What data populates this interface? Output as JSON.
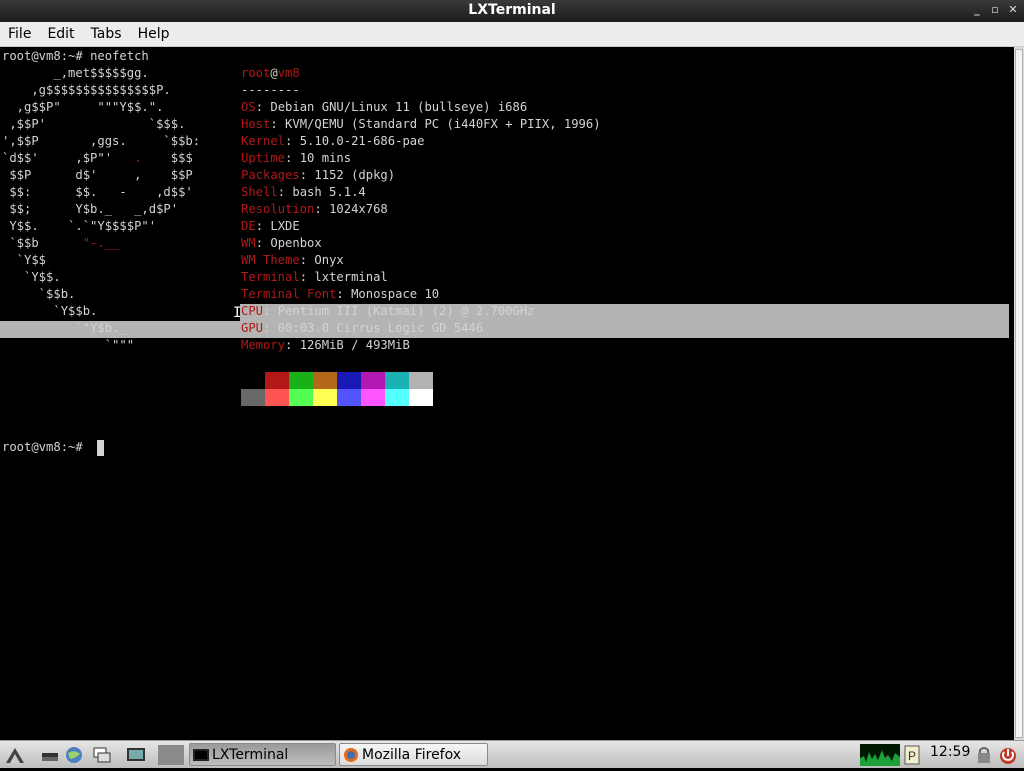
{
  "window": {
    "title": "LXTerminal",
    "buttons": [
      "_",
      "▫",
      "✕"
    ]
  },
  "menu": [
    "File",
    "Edit",
    "Tabs",
    "Help"
  ],
  "terminal": {
    "prompt": "root@vm8:~# ",
    "command": "neofetch",
    "prompt2": "root@vm8:~# ",
    "user": "root",
    "at": "@",
    "host": "vm8",
    "separator": "--------",
    "logo": [
      "       _,met$$$$$gg.",
      "    ,g$$$$$$$$$$$$$$$P.",
      "  ,g$$P\"     \"\"\"Y$$.\".",
      " ,$$P'              `$$$.",
      "',$$P       ,ggs.     `$$b:",
      "`d$$'     ,$P\"'   .    $$$",
      " $$P      d$'     ,    $$P",
      " $$:      $$.   -    ,d$$'",
      " $$;      Y$b._   _,d$P'",
      " Y$$.    `.`\"Y$$$$P\"'",
      " `$$b      \"-.__",
      "  `Y$$",
      "   `Y$$.",
      "     `$$b.",
      "       `Y$$b.",
      "          `\"Y$b._",
      "              `\"\"\""
    ],
    "info": [
      {
        "label": "OS",
        "value": "Debian GNU/Linux 11 (bullseye) i686"
      },
      {
        "label": "Host",
        "value": "KVM/QEMU (Standard PC (i440FX + PIIX, 1996)"
      },
      {
        "label": "Kernel",
        "value": "5.10.0-21-686-pae"
      },
      {
        "label": "Uptime",
        "value": "10 mins"
      },
      {
        "label": "Packages",
        "value": "1152 (dpkg)"
      },
      {
        "label": "Shell",
        "value": "bash 5.1.4"
      },
      {
        "label": "Resolution",
        "value": "1024x768"
      },
      {
        "label": "DE",
        "value": "LXDE"
      },
      {
        "label": "WM",
        "value": "Openbox"
      },
      {
        "label": "WM Theme",
        "value": "Onyx"
      },
      {
        "label": "Terminal",
        "value": "lxterminal"
      },
      {
        "label": "Terminal Font",
        "value": "Monospace 10"
      },
      {
        "label": "CPU",
        "value": "Pentium III (Katmai) (2) @ 2.700GHz"
      },
      {
        "label": "GPU",
        "value": "00:03.0 Cirrus Logic GD 5446"
      },
      {
        "label": "Memory",
        "value": "126MiB / 493MiB"
      }
    ],
    "palette_top": [
      "#000000",
      "#b21818",
      "#18b218",
      "#b26818",
      "#1818b2",
      "#b218b2",
      "#18b2b2",
      "#b2b2b2"
    ],
    "palette_bottom": [
      "#686868",
      "#ff5454",
      "#54ff54",
      "#ffff54",
      "#5454ff",
      "#ff54ff",
      "#54ffff",
      "#ffffff"
    ]
  },
  "taskbar": {
    "tasks": [
      {
        "label": "LXTerminal",
        "active": true
      },
      {
        "label": "Mozilla Firefox",
        "active": false
      }
    ],
    "clock": "12:59"
  }
}
